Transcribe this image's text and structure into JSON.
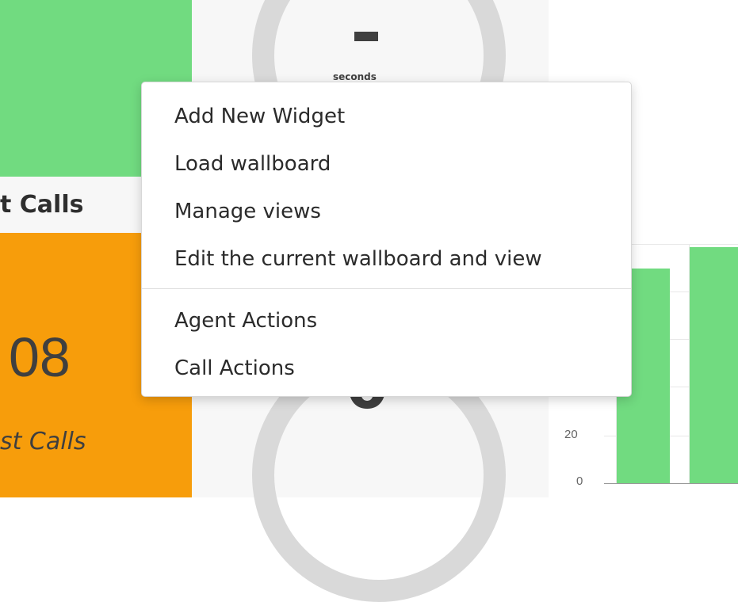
{
  "widgets": {
    "top_left": {
      "color": "#71db80"
    },
    "lost_calls": {
      "title": "t Calls",
      "value": "08",
      "caption": "st Calls",
      "color": "#f79d0b"
    },
    "gauge": {
      "value_top": "-",
      "unit": "seconds",
      "value_bottom": "0"
    },
    "bar_chart": {
      "y_ticks": [
        "20",
        "0"
      ],
      "bar_color": "#71db80"
    }
  },
  "context_menu": {
    "items": [
      {
        "label": "Add New Widget"
      },
      {
        "label": "Load wallboard"
      },
      {
        "label": "Manage views"
      },
      {
        "label": "Edit the current wallboard and view"
      }
    ],
    "secondary_items": [
      {
        "label": "Agent Actions"
      },
      {
        "label": "Call Actions"
      }
    ]
  }
}
